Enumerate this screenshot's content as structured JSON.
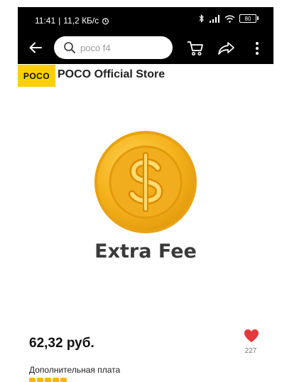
{
  "status_bar": {
    "time": "11:41",
    "speed": "11,2 КБ/с",
    "battery": "80"
  },
  "search": {
    "placeholder": "poco f4"
  },
  "store": {
    "logo_text": "POCO",
    "name": "POCO Official Store"
  },
  "product": {
    "image_title": "Extra Fee",
    "price": "62,32 руб.",
    "favorites_count": "227",
    "name": "Дополнительная плата"
  },
  "colors": {
    "brand_yellow": "#ffcf00",
    "heart": "#e4393c",
    "coin": "#f5b21c"
  },
  "icons": [
    "back-icon",
    "search-icon",
    "cart-icon",
    "share-icon",
    "more-icon",
    "heart-icon",
    "coin-image"
  ]
}
